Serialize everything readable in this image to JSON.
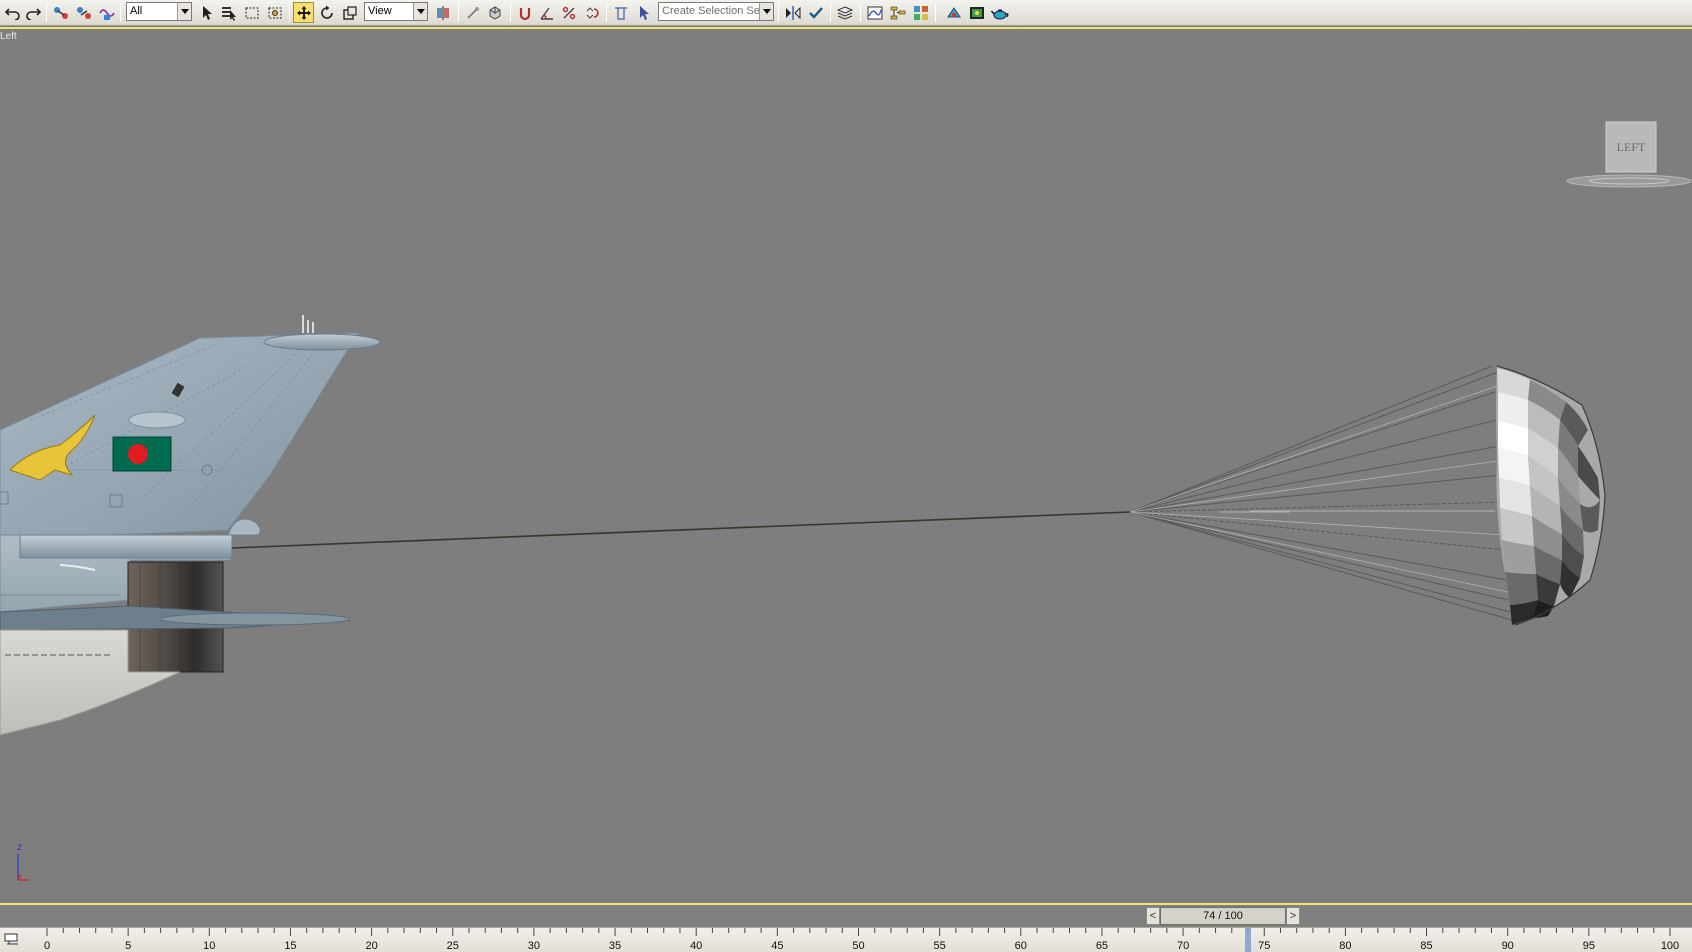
{
  "toolbar": {
    "selection_filter": "All",
    "reference_coord": "View",
    "named_selection_placeholder": "Create Selection Set"
  },
  "viewport": {
    "label": "Left",
    "viewcube_label": "LEFT",
    "axis_label": "z"
  },
  "time_slider": {
    "frame_readout": "74 / 100",
    "current_frame": 74,
    "total_frames": 100,
    "prev_symbol": "<",
    "next_symbol": ">"
  },
  "trackbar": {
    "tick_labels": [
      "0",
      "5",
      "10",
      "15",
      "20",
      "25",
      "30",
      "35",
      "40",
      "45",
      "50",
      "55",
      "60",
      "65",
      "70",
      "75",
      "80",
      "85",
      "90",
      "95",
      "100"
    ]
  },
  "colors": {
    "active_tool": "#f7df72",
    "viewport_border": "#f0e36a",
    "viewport_bg": "#7e7e7e",
    "flag_green": "#006a4e",
    "flag_red": "#e01b22",
    "emblem_yellow": "#e8c43a"
  }
}
